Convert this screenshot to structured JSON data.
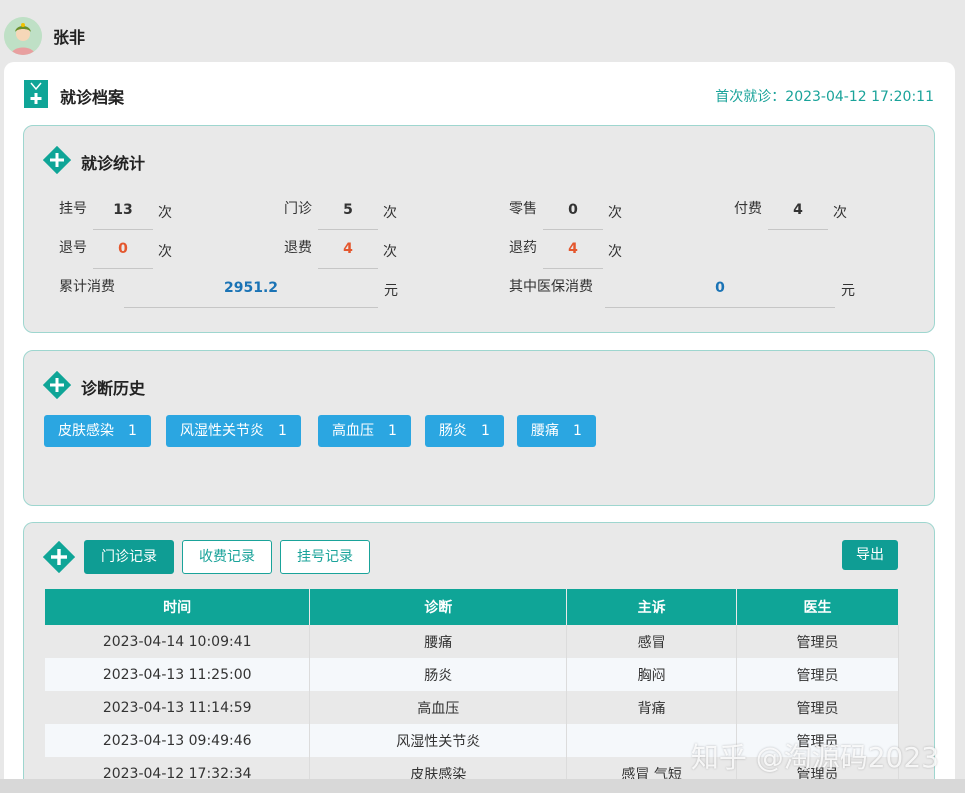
{
  "user": {
    "name": "张非"
  },
  "header": {
    "title": "就诊档案",
    "first_visit": "首次就诊：2023-04-12 17:20:11"
  },
  "stats": {
    "title": "就诊统计",
    "items": [
      {
        "label": "挂号",
        "value": "13",
        "unit": "次"
      },
      {
        "label": "门诊",
        "value": "5",
        "unit": "次"
      },
      {
        "label": "零售",
        "value": "0",
        "unit": "次"
      },
      {
        "label": "付费",
        "value": "4",
        "unit": "次"
      },
      {
        "label": "退号",
        "value": "0",
        "unit": "次"
      },
      {
        "label": "退费",
        "value": "4",
        "unit": "次"
      },
      {
        "label": "退药",
        "value": "4",
        "unit": "次"
      },
      {
        "label": "累计消费",
        "value": "2951.2",
        "unit": "元"
      },
      {
        "label": "其中医保消费",
        "value": "0",
        "unit": "元"
      }
    ]
  },
  "history": {
    "title": "诊断历史",
    "tags": [
      {
        "name": "皮肤感染",
        "count": "1"
      },
      {
        "name": "风湿性关节炎",
        "count": "1"
      },
      {
        "name": "高血压",
        "count": "1"
      },
      {
        "name": "肠炎",
        "count": "1"
      },
      {
        "name": "腰痛",
        "count": "1"
      }
    ]
  },
  "records": {
    "tabs": [
      "门诊记录",
      "收费记录",
      "挂号记录"
    ],
    "export_label": "导出",
    "columns": [
      "时间",
      "诊断",
      "主诉",
      "医生"
    ],
    "rows": [
      [
        "2023-04-14 10:09:41",
        "腰痛",
        "感冒",
        "管理员"
      ],
      [
        "2023-04-13 11:25:00",
        "肠炎",
        "胸闷",
        "管理员"
      ],
      [
        "2023-04-13 11:14:59",
        "高血压",
        "背痛",
        "管理员"
      ],
      [
        "2023-04-13 09:49:46",
        "风湿性关节炎",
        "",
        "管理员"
      ],
      [
        "2023-04-12 17:32:34",
        "皮肤感染",
        "感冒 气短",
        "管理员"
      ]
    ]
  },
  "watermark": "知乎 @淘源码2023",
  "colors": {
    "accent": "#0f9d94",
    "tag": "#2ba6e1",
    "danger": "#e4572e",
    "link": "#1a73b5"
  }
}
